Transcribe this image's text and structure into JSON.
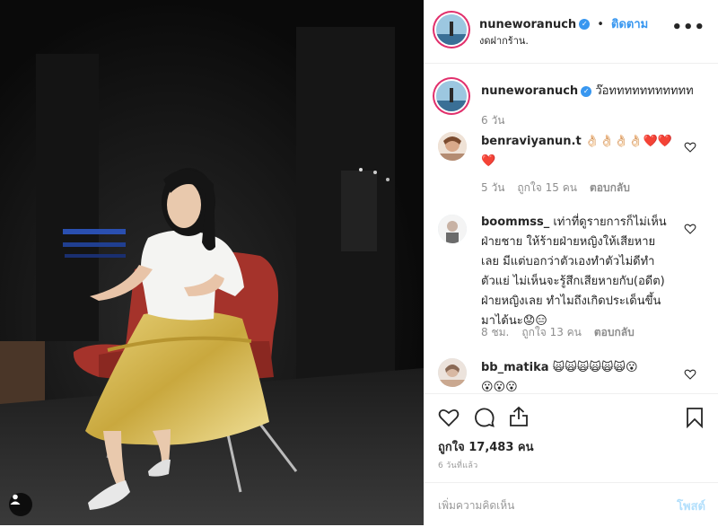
{
  "post": {
    "username": "nuneworanuch",
    "follow_label": "ติดตาม",
    "location": "งดฝากร้าน.",
    "more_icon": "more-options-icon",
    "photo_tag_icon": "person-tag-icon"
  },
  "caption": {
    "username": "nuneworanuch",
    "text": "ว๊อททททททททททท",
    "time": "6 วัน"
  },
  "comments": [
    {
      "username": "benraviyanun.t",
      "text": "👌🏻👌🏻👌🏻👌🏻❤️❤️",
      "text2": "❤️",
      "time": "5 วัน",
      "likes": "ถูกใจ 15 คน",
      "reply": "ตอบกลับ"
    },
    {
      "username": "boommss_",
      "text_lines": [
        "เท่าที่ดูรายการก็ไม่เห็น",
        "ฝ่ายชาย ให้ร้ายฝ่ายหญิงให้เสียหาย",
        "เลย มีแต่บอกว่าตัวเองทำตัวไม่ดีทำ",
        "ตัวแย่ ไม่เห็นจะรู้สึกเสียหายกับ(อดีต)",
        "ฝ่ายหญิงเลย ทำไมถึงเกิดประเด็นขึ้น",
        "มาได้นะ😟😑"
      ],
      "time": "8 ชม.",
      "likes": "ถูกใจ 13 คน",
      "reply": "ตอบกลับ"
    },
    {
      "username": "bb_matika",
      "text": "🙀🙀🙀🙀🙀🙀😮",
      "text2": "😮😮😮"
    }
  ],
  "actions": {
    "likes": "ถูกใจ 17,483 คน",
    "time": "6 วันที่แล้ว"
  },
  "comment_input": {
    "placeholder": "เพิ่มความคิดเห็น",
    "post_label": "โพสต์"
  },
  "colors": {
    "link": "#3897f0",
    "post_disabled": "#b2dffc",
    "meta": "#8e8e8e"
  }
}
